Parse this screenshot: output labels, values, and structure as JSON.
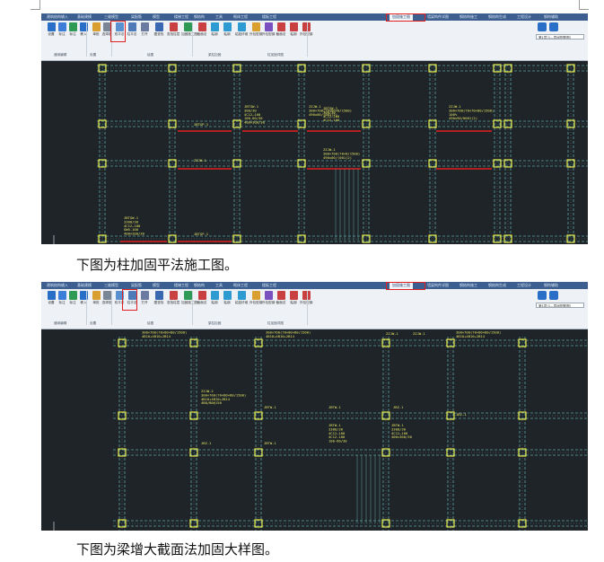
{
  "captions": {
    "first": "下图为柱加固平法施工图。",
    "second": "下图为梁增大截面法加固大样图。"
  },
  "ribbon": {
    "tabs": [
      "建筑结构输入",
      "基础建模",
      "三维模型",
      "梁配筋",
      "模型",
      "楼梯工程",
      "钢结构",
      "工具",
      "砌体工程",
      "楼板工程",
      "加固施工图",
      "墙梁构件详图",
      "钢结构施工",
      "钢结构生成",
      "工程设计",
      "钢构辅助"
    ],
    "active_tab": "加固施工图",
    "tools": [
      "设置",
      "标注",
      "标注",
      "移入",
      "单批",
      "选择批",
      "双平法",
      "柱平法",
      "打开",
      "图查找",
      "查找柱层",
      "加固施工图",
      "截面法",
      "粘钢",
      "粘钢",
      "粘贴纤维",
      "外包型钢",
      "外包型钢",
      "截面法",
      "粘钢",
      "外包型钢"
    ],
    "group_labels": [
      "通用编辑",
      "设置",
      "绘图",
      "梁柱加固",
      "柱加固详图"
    ],
    "combo_text": "第1层(1—层间配筋图)"
  },
  "drawing1": {
    "labels": [
      {
        "t": "JBTGW-1\n3300/30\n4C12—100\nGW5-100\n400×200/30"
      },
      {
        "t": "JBTGW-1\n300/30\n4C12—100\n100-60/30\n400×300/30"
      },
      {
        "t": "ZZJW-1\n300×700(70×70×80/1500)\n100%\n490x90/0001(2)"
      },
      {
        "t": "JBTGP-1"
      },
      {
        "t": "ZZJW-1"
      },
      {
        "t": "ZZJW-1\n300×700(70×80×8/1500)\n490x00/(001(2)"
      },
      {
        "t": "ZZJW-1\n300×700(70×8/1500)\n490x00/(001(2)"
      },
      {
        "t": "JBTGW-1\n300/30\n4C12—100\n4C12-100"
      },
      {
        "t": "JBTGP-1"
      }
    ]
  },
  "drawing2": {
    "labels": [
      {
        "t": "ZZJW-1\n300×700(70×80×80/1500)\n4B10+4B10+2B14"
      },
      {
        "t": "ZZJW-1"
      },
      {
        "t": "ZZJW-1\n300×700(70×80×80/1500)\n4B10+4B10+2B14"
      },
      {
        "t": "ZZJW-1"
      },
      {
        "t": "ZZJW-1"
      },
      {
        "t": "ZZJW-1\n300×700(70×80×80/1500)\n4B10+4B10+2B14"
      },
      {
        "t": "ZZJW-2\n300×700(70×80×80/1500)\n4B10+4B10+2B14\n4B8/B0@150"
      },
      {
        "t": "JBTW-1"
      },
      {
        "t": "JBTW-1"
      },
      {
        "t": "JBTW-1"
      },
      {
        "t": "JBTW-1\n3300/30\n4C12—100\n4C12-100\n100-60/30"
      },
      {
        "t": "JBTW-1\n3300/30\n4C12—100\n400×300/30"
      },
      {
        "t": "JBZ-1"
      },
      {
        "t": "JBZ-1"
      },
      {
        "t": "JBZ-1"
      }
    ]
  },
  "colors": {
    "canvas": "#1f2429",
    "grid": "#5fa3a3",
    "column": "#e8e84a",
    "text": "#e4e462",
    "highlight": "#e22020"
  }
}
